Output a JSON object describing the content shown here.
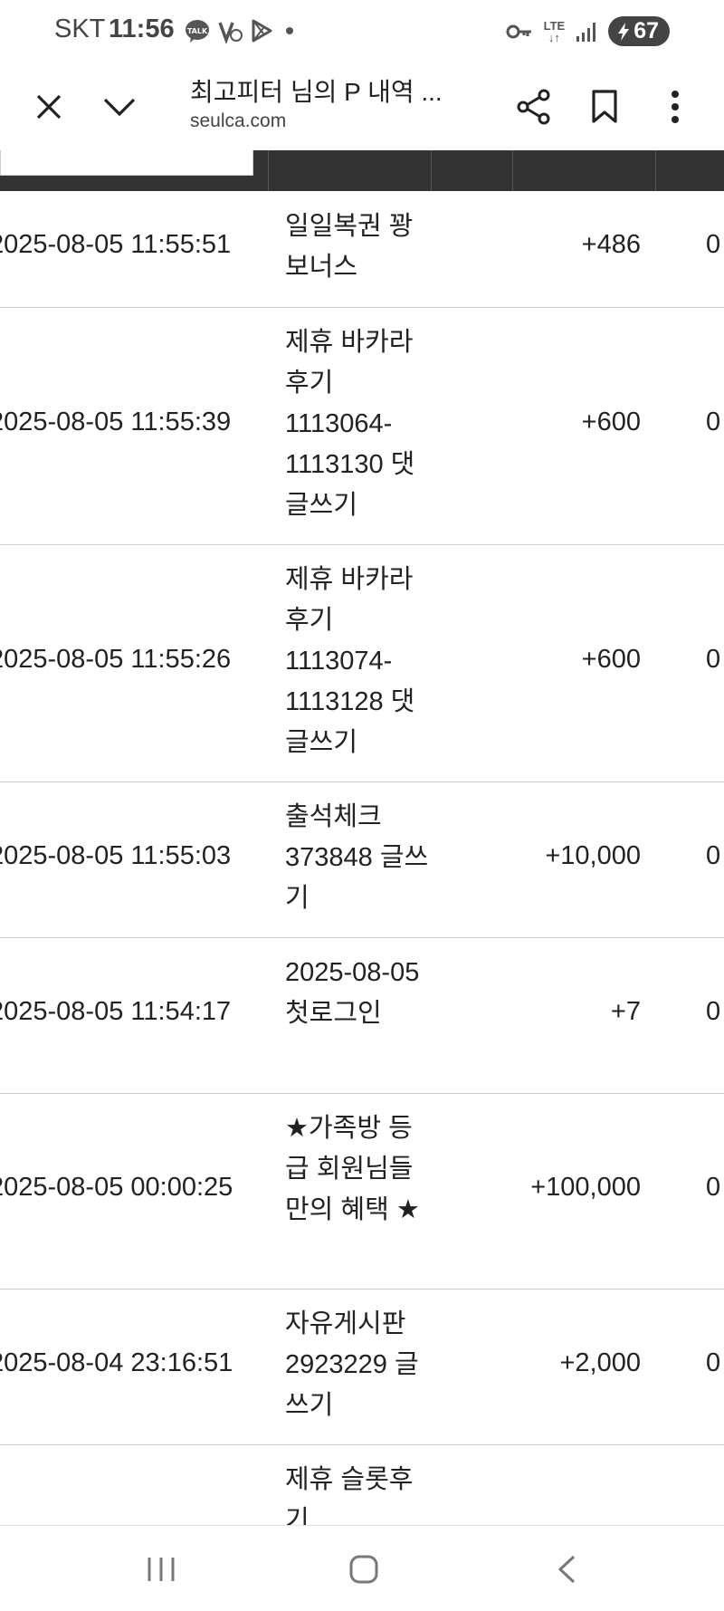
{
  "status_bar": {
    "carrier": "SKT",
    "time": "11:56",
    "battery": "67"
  },
  "toolbar": {
    "title": "최고피터 님의 P 내역 ...",
    "url": "seulca.com"
  },
  "rows": [
    {
      "date": "2025-08-05 11:55:51",
      "desc": "일일복권 꽝 보너스",
      "amount": "+486",
      "balance": "0"
    },
    {
      "date": "2025-08-05 11:55:39",
      "desc": "제휴 바카라 후기 1113064-1113130 댓글쓰기",
      "amount": "+600",
      "balance": "0"
    },
    {
      "date": "2025-08-05 11:55:26",
      "desc": "제휴 바카라 후기 1113074-1113128 댓글쓰기",
      "amount": "+600",
      "balance": "0"
    },
    {
      "date": "2025-08-05 11:55:03",
      "desc": "출석체크 373848 글쓰기",
      "amount": "+10,000",
      "balance": "0"
    },
    {
      "date": "2025-08-05 11:54:17",
      "desc": "2025-08-05 첫로그인",
      "amount": "+7",
      "balance": "0"
    },
    {
      "date": "2025-08-05 00:00:25",
      "desc": "★가족방 등급 회원님들만의 혜택 ★",
      "amount": "+100,000",
      "balance": "0"
    },
    {
      "date": "2025-08-04 23:16:51",
      "desc": "자유게시판 2923229 글쓰기",
      "amount": "+2,000",
      "balance": "0"
    },
    {
      "date": "",
      "desc": "제휴 슬롯후기",
      "amount": "",
      "balance": ""
    }
  ]
}
